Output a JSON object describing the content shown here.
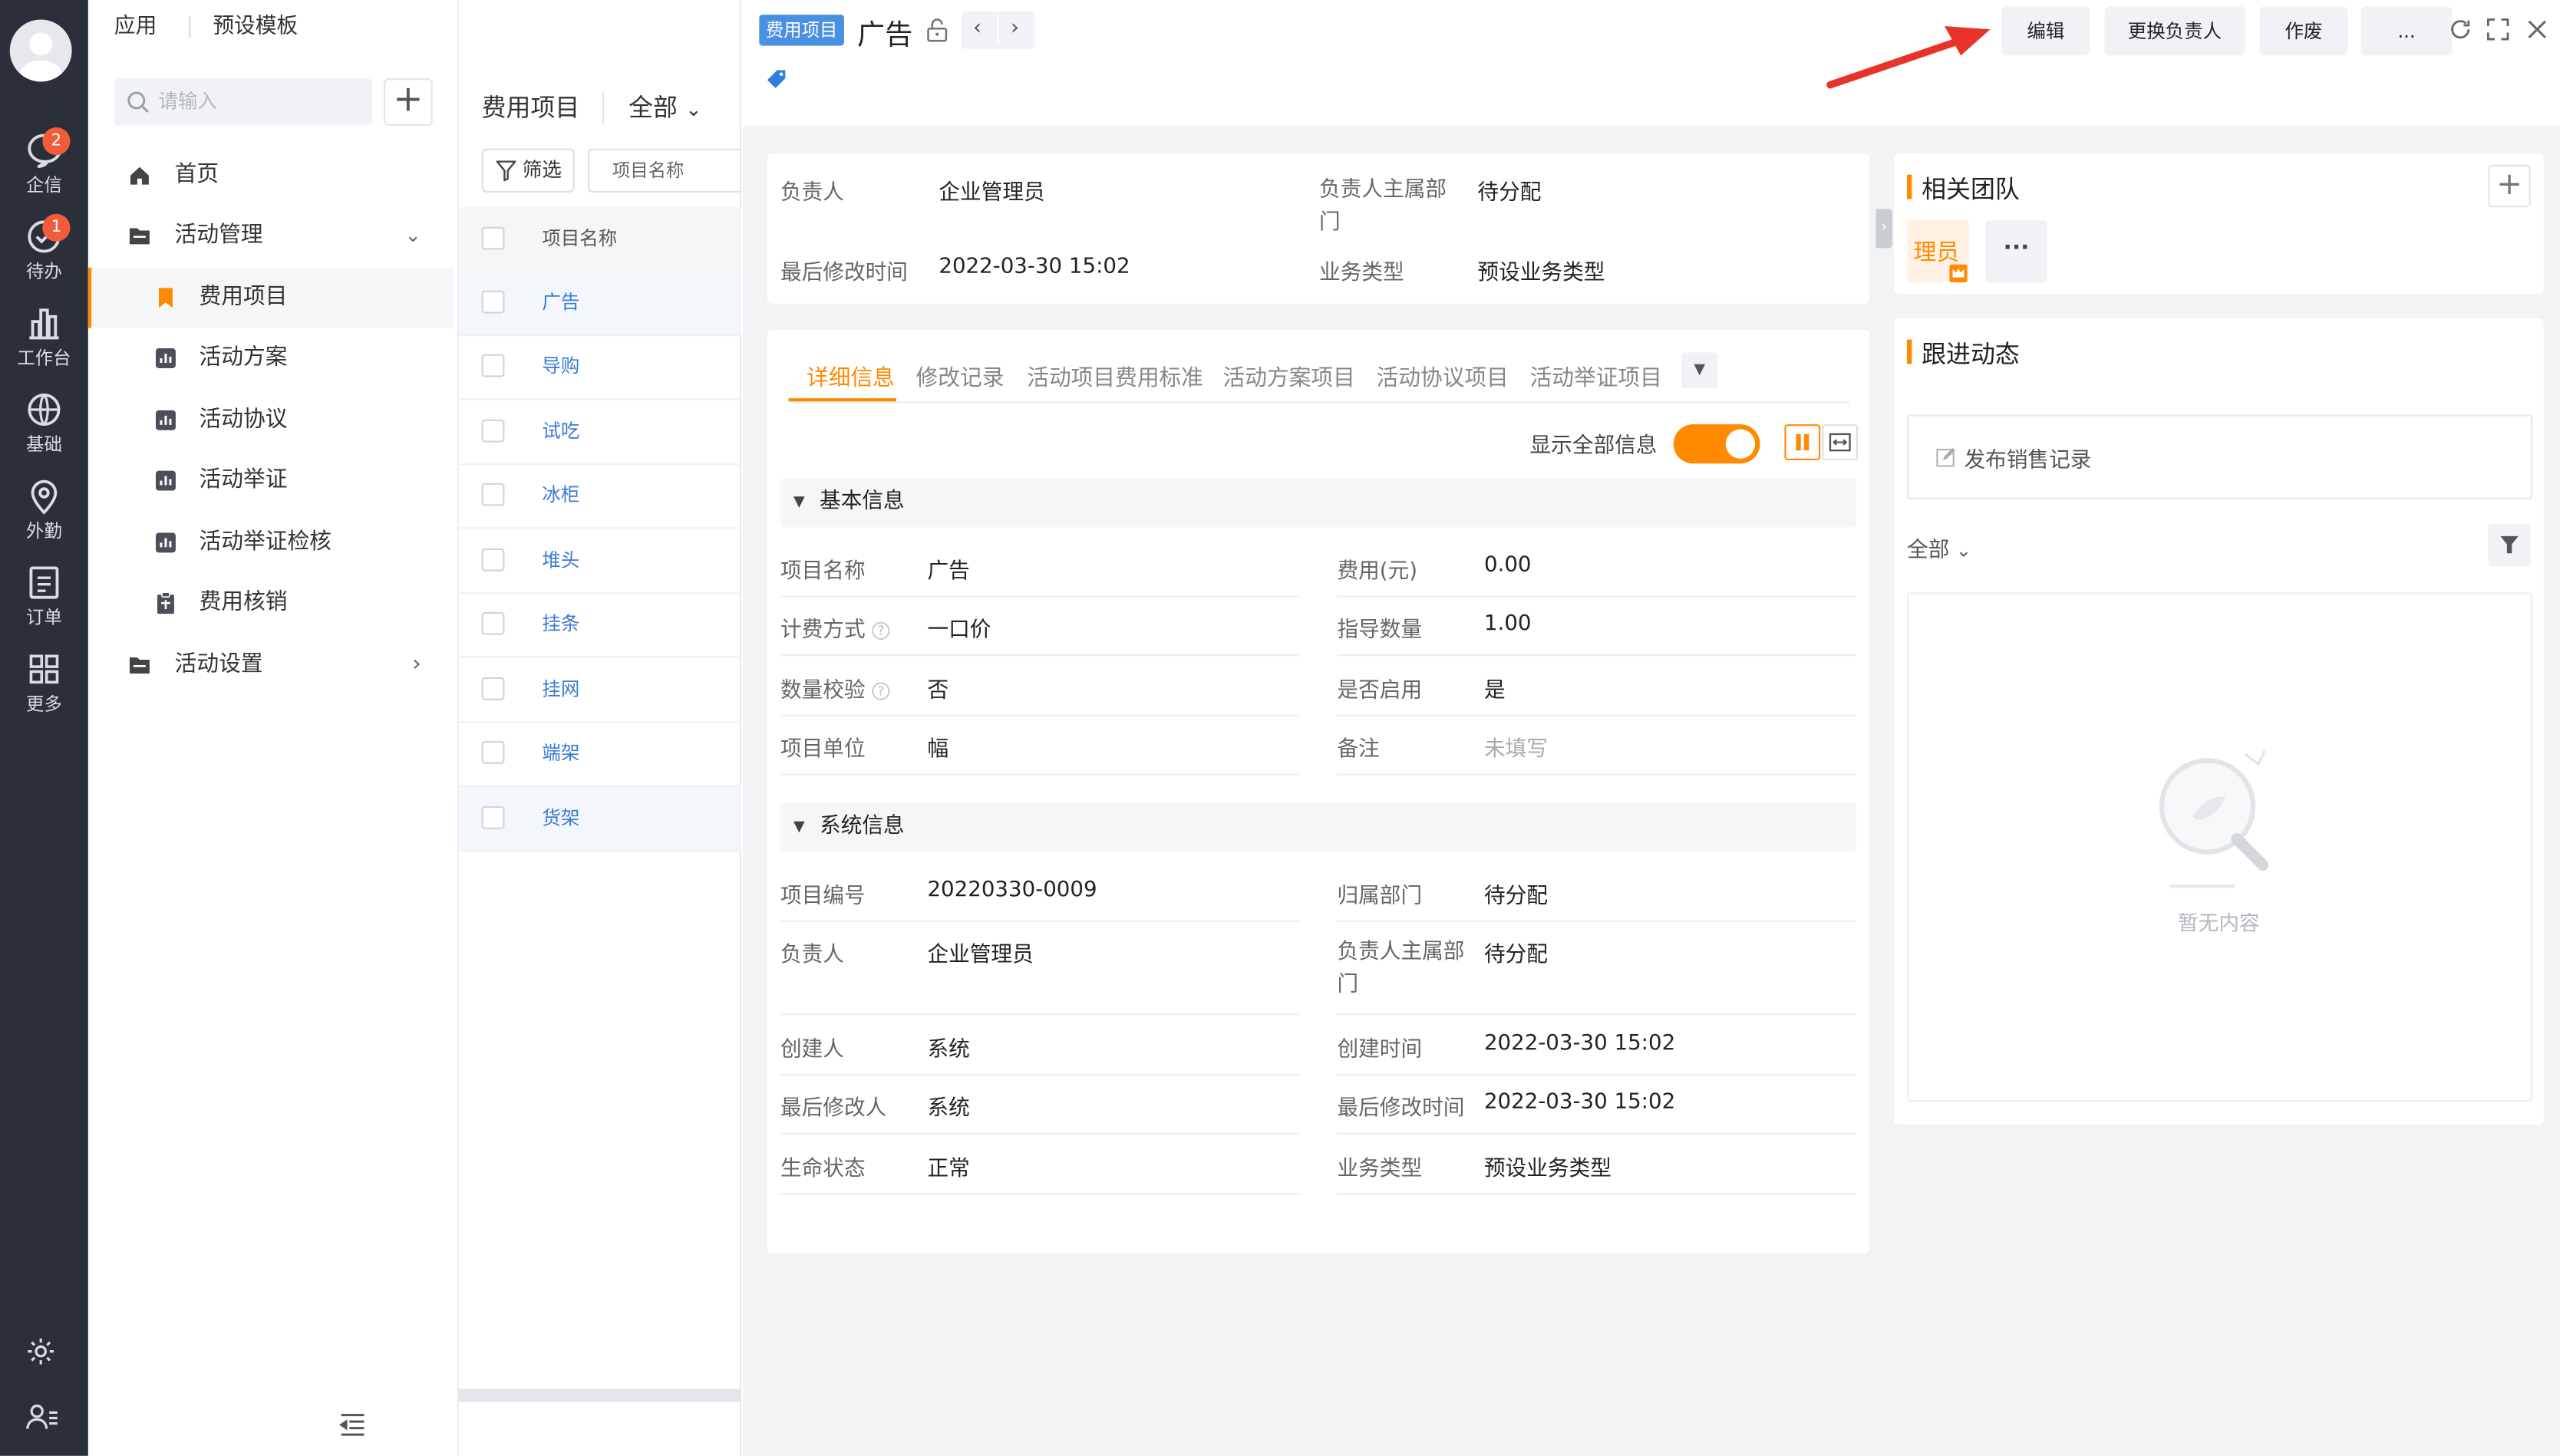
{
  "rail": {
    "items": [
      {
        "label": "企信",
        "badge": "2"
      },
      {
        "label": "待办",
        "badge": "1"
      },
      {
        "label": "工作台"
      },
      {
        "label": "基础"
      },
      {
        "label": "外勤"
      },
      {
        "label": "订单"
      },
      {
        "label": "更多"
      }
    ]
  },
  "nav": {
    "top_tabs": [
      "应用",
      "预设模板"
    ],
    "search_placeholder": "请输入",
    "add_label": "+",
    "menu": [
      {
        "label": "首页"
      },
      {
        "label": "活动管理"
      },
      {
        "label": "费用项目"
      },
      {
        "label": "活动方案"
      },
      {
        "label": "活动协议"
      },
      {
        "label": "活动举证"
      },
      {
        "label": "活动举证检核"
      },
      {
        "label": "费用核销"
      },
      {
        "label": "活动设置"
      }
    ]
  },
  "list": {
    "title": "费用项目",
    "scope": "全部",
    "filter_label": "筛选",
    "column_filter": "项目名称",
    "header": "项目名称",
    "rows": [
      "广告",
      "导购",
      "试吃",
      "冰柜",
      "堆头",
      "挂条",
      "挂网",
      "端架",
      "货架"
    ]
  },
  "detail": {
    "tag": "费用项目",
    "title": "广告",
    "actions": [
      "编辑",
      "更换负责人",
      "作废",
      "..."
    ],
    "summary": {
      "owner_label": "负责人",
      "owner": "企业管理员",
      "dept_label": "负责人主属部门",
      "dept": "待分配",
      "modified_label": "最后修改时间",
      "modified": "2022-03-30 15:02",
      "biztype_label": "业务类型",
      "biztype": "预设业务类型"
    },
    "tabs": [
      "详细信息",
      "修改记录",
      "活动项目费用标准",
      "活动方案项目",
      "活动协议项目",
      "活动举证项目"
    ],
    "show_all_label": "显示全部信息",
    "basic": {
      "title": "基本信息",
      "fields": [
        {
          "label": "项目名称",
          "value": "广告"
        },
        {
          "label": "费用(元)",
          "value": "0.00"
        },
        {
          "label": "计费方式",
          "value": "一口价"
        },
        {
          "label": "指导数量",
          "value": "1.00"
        },
        {
          "label": "数量校验",
          "value": "否"
        },
        {
          "label": "是否启用",
          "value": "是"
        },
        {
          "label": "项目单位",
          "value": "幅"
        },
        {
          "label": "备注",
          "value": "未填写"
        }
      ]
    },
    "system": {
      "title": "系统信息",
      "fields": [
        {
          "label": "项目编号",
          "value": "20220330-0009"
        },
        {
          "label": "归属部门",
          "value": "待分配"
        },
        {
          "label": "负责人",
          "value": "企业管理员"
        },
        {
          "label": "负责人主属部门",
          "value": "待分配"
        },
        {
          "label": "创建人",
          "value": "系统"
        },
        {
          "label": "创建时间",
          "value": "2022-03-30 15:02"
        },
        {
          "label": "最后修改人",
          "value": "系统"
        },
        {
          "label": "最后修改时间",
          "value": "2022-03-30 15:02"
        },
        {
          "label": "生命状态",
          "value": "正常"
        },
        {
          "label": "业务类型",
          "value": "预设业务类型"
        }
      ]
    }
  },
  "team": {
    "title": "相关团队",
    "member": "理员",
    "more": "···"
  },
  "follow": {
    "title": "跟进动态",
    "publish": "发布销售记录",
    "filter": "全部",
    "empty": "暂无内容"
  },
  "colors": {
    "accent": "#ff8a00",
    "rail": "#2b2f3a",
    "link": "#3a7bd5",
    "tag": "#4a90e2",
    "arrow": "#e8332a"
  }
}
